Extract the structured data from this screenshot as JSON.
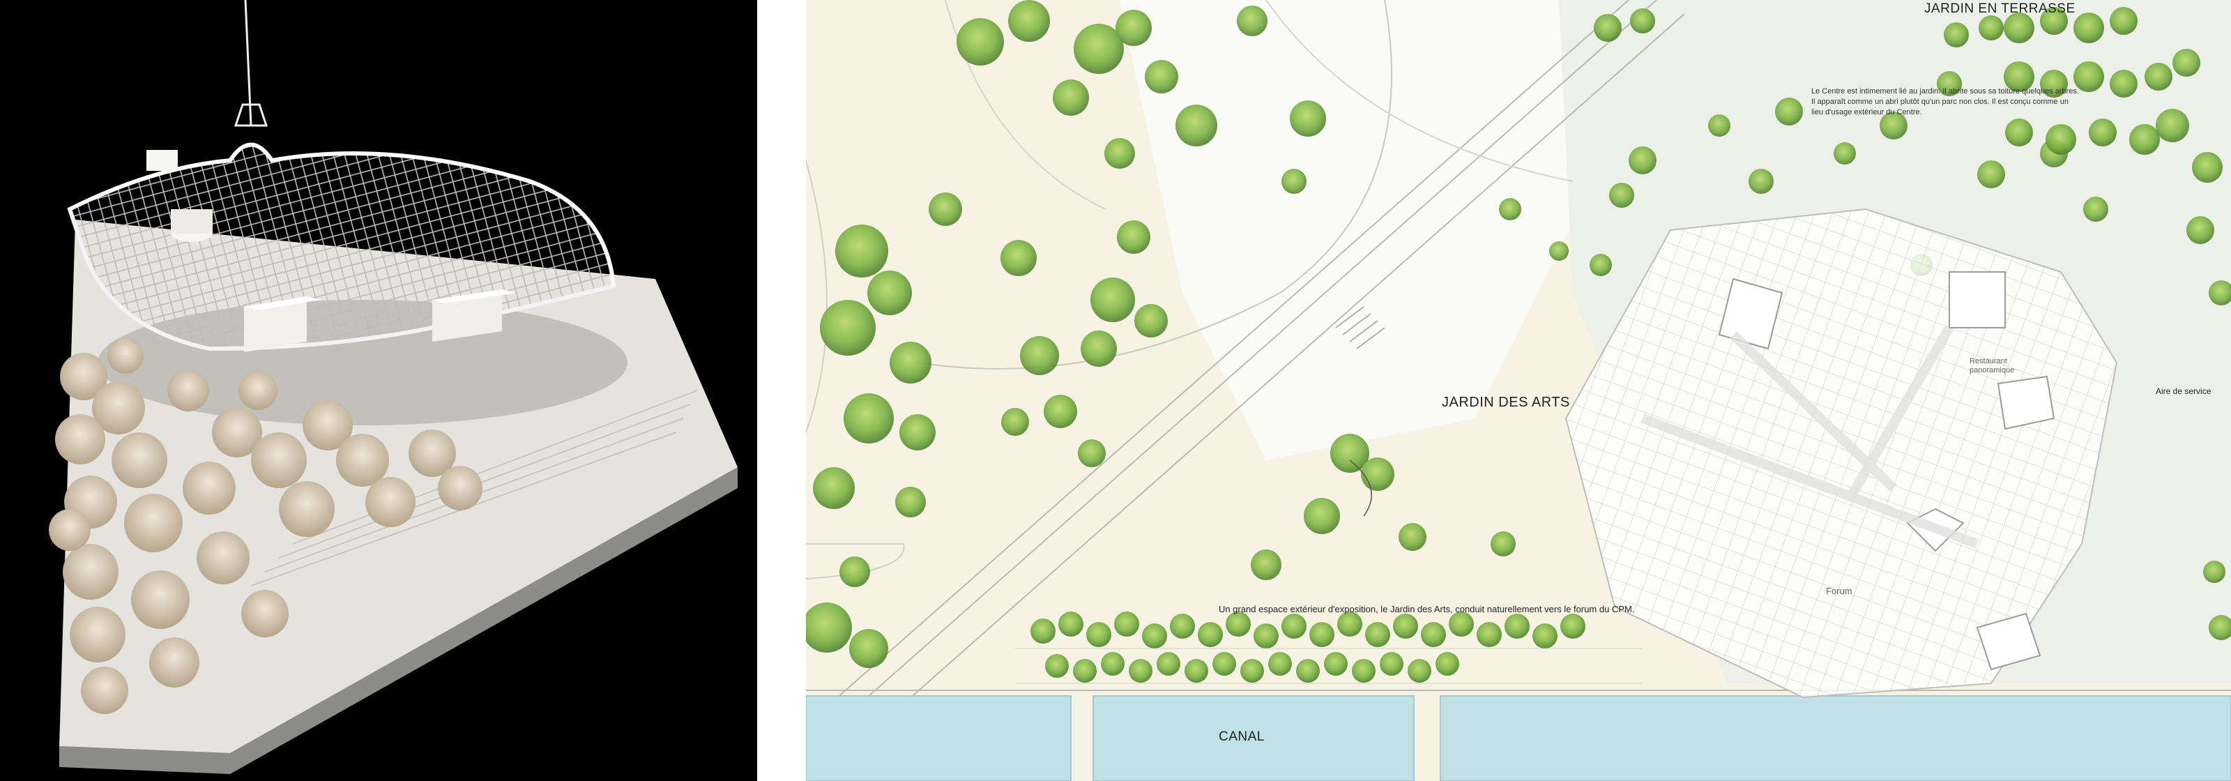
{
  "labels": {
    "garden": "JARDIN DES ARTS",
    "terrace": "JARDIN EN TERRASSE",
    "canal": "CANAL",
    "service_area": "Aire de service",
    "restaurant": "Restaurant panoramique",
    "forum": "Forum",
    "caption": "Un grand espace extérieur d'exposition, le Jardin des Arts, conduit naturellement vers le forum du CPM.",
    "terrace_note": "Le Centre est intimement lié au jardin. Il abrite sous sa toiture quelques arbres. Il apparaît comme un abri plutôt qu'un parc non clos. Il est conçu comme un lieu d'usage extérieur du Centre."
  },
  "colors": {
    "model_background": "#000000",
    "plan_ground": "#f6f3e4",
    "water": "#bfe0e4",
    "tree_green": "#7cb342",
    "roof_grid": "#c9c9c9"
  }
}
